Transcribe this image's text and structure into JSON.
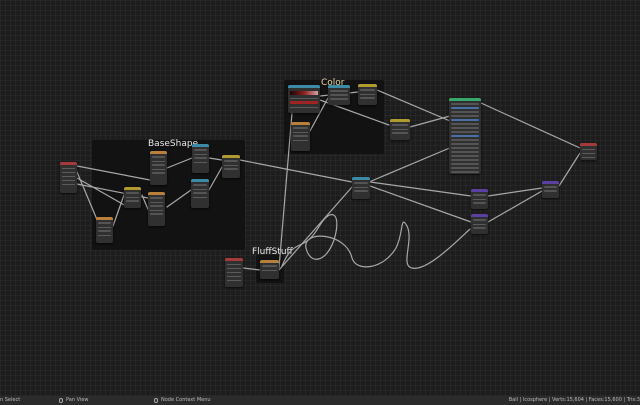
{
  "frames": {
    "baseshape": {
      "label": "BaseShape"
    },
    "color": {
      "label": "Color"
    },
    "fluffstuff": {
      "label": "FluffStuff"
    }
  },
  "header_colors": {
    "input": "#a53a3a",
    "vector": "#5b3fa3",
    "texture": "#b8803a",
    "converter": "#3d8aa5",
    "color": "#b29b2e",
    "shader": "#38a86a"
  },
  "statusbar": {
    "select_label": "n Select",
    "pan_label": "Pan View",
    "context_label": "Node Context Menu",
    "scene_stats": "Ball | Icosphere | Verts:15,604 | Faces:15,600 | Tris:3"
  }
}
